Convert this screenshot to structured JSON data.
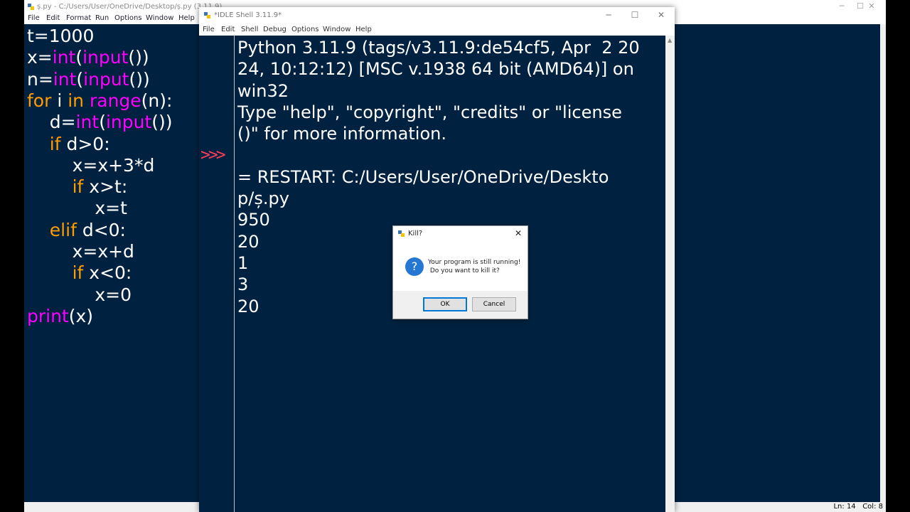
{
  "editor": {
    "title": "ș.py - C:/Users/User/OneDrive/Desktop/ș.py (3.11.9)",
    "menu": [
      "File",
      "Edit",
      "Format",
      "Run",
      "Options",
      "Window",
      "Help"
    ],
    "code_lines": [
      [
        {
          "t": "t=1000",
          "c": ""
        }
      ],
      [
        {
          "t": "x=",
          "c": ""
        },
        {
          "t": "int",
          "c": "bi"
        },
        {
          "t": "(",
          "c": ""
        },
        {
          "t": "input",
          "c": "bi"
        },
        {
          "t": "())",
          "c": ""
        }
      ],
      [
        {
          "t": "n=",
          "c": ""
        },
        {
          "t": "int",
          "c": "bi"
        },
        {
          "t": "(",
          "c": ""
        },
        {
          "t": "input",
          "c": "bi"
        },
        {
          "t": "())",
          "c": ""
        }
      ],
      [
        {
          "t": "for",
          "c": "kw"
        },
        {
          "t": " i ",
          "c": ""
        },
        {
          "t": "in",
          "c": "kw"
        },
        {
          "t": " ",
          "c": ""
        },
        {
          "t": "range",
          "c": "bi"
        },
        {
          "t": "(n):",
          "c": ""
        }
      ],
      [
        {
          "t": "    d=",
          "c": ""
        },
        {
          "t": "int",
          "c": "bi"
        },
        {
          "t": "(",
          "c": ""
        },
        {
          "t": "input",
          "c": "bi"
        },
        {
          "t": "())",
          "c": ""
        }
      ],
      [
        {
          "t": "    ",
          "c": ""
        },
        {
          "t": "if",
          "c": "kw"
        },
        {
          "t": " d>0:",
          "c": ""
        }
      ],
      [
        {
          "t": "        x=x+3*d",
          "c": ""
        }
      ],
      [
        {
          "t": "        ",
          "c": ""
        },
        {
          "t": "if",
          "c": "kw"
        },
        {
          "t": " x>t:",
          "c": ""
        }
      ],
      [
        {
          "t": "            x=t",
          "c": ""
        }
      ],
      [
        {
          "t": "    ",
          "c": ""
        },
        {
          "t": "elif",
          "c": "kw"
        },
        {
          "t": " d<0:",
          "c": ""
        }
      ],
      [
        {
          "t": "        x=x+d",
          "c": ""
        }
      ],
      [
        {
          "t": "        ",
          "c": ""
        },
        {
          "t": "if",
          "c": "kw"
        },
        {
          "t": " x<0:",
          "c": ""
        }
      ],
      [
        {
          "t": "            x=0",
          "c": ""
        }
      ],
      [
        {
          "t": "print",
          "c": "bi"
        },
        {
          "t": "(x)",
          "c": ""
        }
      ]
    ],
    "status": "Ln: 14   Col: 8"
  },
  "shell": {
    "title": "*IDLE Shell 3.11.9*",
    "menu": [
      "File",
      "Edit",
      "Shell",
      "Debug",
      "Options",
      "Window",
      "Help"
    ],
    "prompt": ">>>",
    "lines": [
      "Python 3.11.9 (tags/v3.11.9:de54cf5, Apr  2 20",
      "24, 10:12:12) [MSC v.1938 64 bit (AMD64)] on",
      "win32",
      "Type \"help\", \"copyright\", \"credits\" or \"license",
      "()\" for more information.",
      "",
      "= RESTART: C:/Users/User/OneDrive/Deskto",
      "p/ș.py",
      "950",
      "20",
      "1",
      "3",
      "20"
    ]
  },
  "dialog": {
    "title": "Kill?",
    "message_line1": "Your program is still running!",
    "message_line2": " Do you want to kill it?",
    "ok_label": "OK",
    "cancel_label": "Cancel"
  },
  "window_controls": {
    "minimize": "─",
    "maximize": "☐",
    "close": "✕"
  }
}
